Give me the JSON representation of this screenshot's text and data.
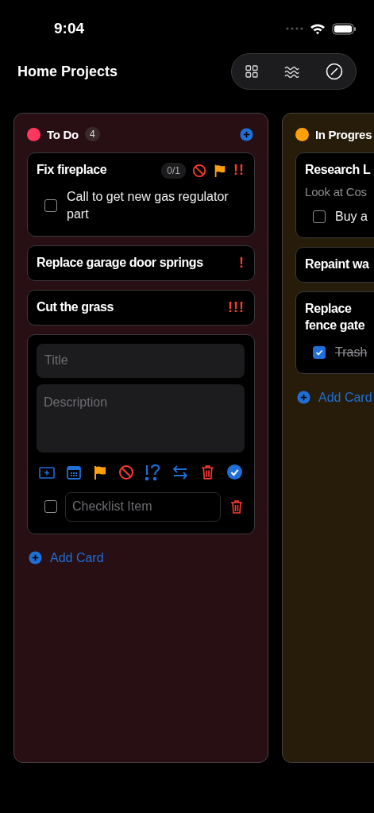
{
  "status_bar": {
    "time": "9:04"
  },
  "header": {
    "title": "Home Projects"
  },
  "columns": [
    {
      "name": "To Do",
      "color": "#ff375f",
      "count": "4",
      "cards": [
        {
          "kind": "card",
          "title": "Fix fireplace",
          "progress": "0/1",
          "blocked": true,
          "flagged": true,
          "priority": "!!",
          "checklist": [
            {
              "text": "Call to get new gas regulator part",
              "checked": false
            }
          ]
        },
        {
          "kind": "card",
          "title": "Replace garage door springs",
          "priority": "!"
        },
        {
          "kind": "card",
          "title": "Cut the grass",
          "priority": "!!!"
        },
        {
          "kind": "editor",
          "title_placeholder": "Title",
          "description_placeholder": "Description",
          "checklist_placeholder": "Checklist Item",
          "checklist_checked": false
        }
      ],
      "add_label": "Add Card"
    },
    {
      "name": "In Progres",
      "color": "#ff9f0a",
      "cards": [
        {
          "kind": "card",
          "title": "Research L",
          "description": "Look at Cos",
          "checklist": [
            {
              "text": "Buy a",
              "checked": false
            }
          ]
        },
        {
          "kind": "card",
          "title": "Repaint wa"
        },
        {
          "kind": "card",
          "title": "Replace\nfence gate",
          "checklist": [
            {
              "text": "Trash",
              "checked": true
            }
          ]
        }
      ],
      "add_label": "Add Card"
    }
  ]
}
